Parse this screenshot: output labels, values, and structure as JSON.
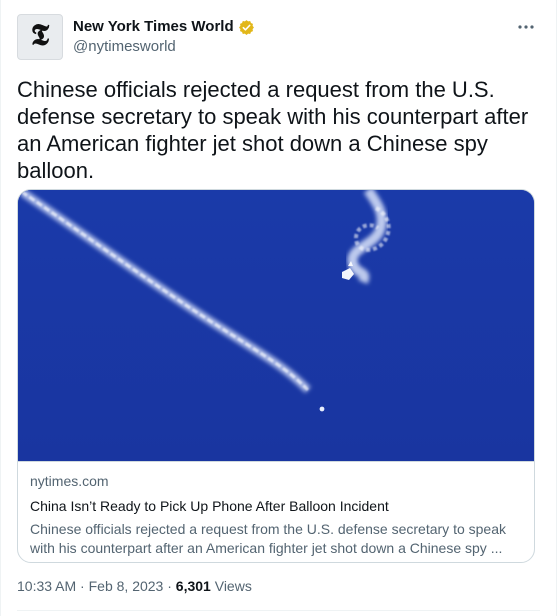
{
  "author": {
    "display_name": "New York Times World",
    "handle": "@nytimesworld",
    "avatar_glyph": "𝕿",
    "avatar_icon": "nyt-logo-icon",
    "verified_icon": "verified-badge-icon",
    "verified_color": "#e2b719"
  },
  "tweet": {
    "text": "Chinese officials rejected a request from the U.S. defense secretary to speak with his counterpart after an American fighter jet shot down a Chinese spy balloon."
  },
  "card": {
    "domain": "nytimes.com",
    "title": "China Isn’t Ready to Pick Up Phone After Balloon Incident",
    "description": "Chinese officials rejected a request from the U.S. defense secretary to speak with his counterpart after an American fighter jet shot down a Chinese spy ...",
    "image_bg_color": "#1938a6"
  },
  "meta": {
    "time": "10:33 AM",
    "separator": "·",
    "date": "Feb 8, 2023",
    "views_count": "6,301",
    "views_label": "Views"
  },
  "menu": {
    "more_icon": "more-options-icon"
  }
}
